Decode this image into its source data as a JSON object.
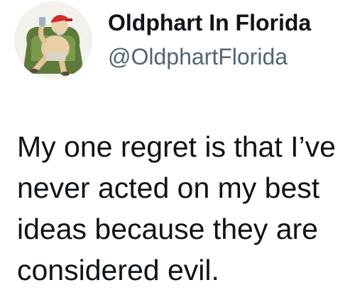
{
  "author": {
    "display_name": "Oldphart In Florida",
    "handle": "@OldphartFlorida",
    "avatar_icon": "cartoon-old-man-in-armchair-avatar"
  },
  "tweet": {
    "text": "My one regret is that I’ve never acted on my best ideas because they are considered evil."
  },
  "colors": {
    "text": "#0f1419",
    "secondary_text": "#536471",
    "background": "#ffffff"
  }
}
